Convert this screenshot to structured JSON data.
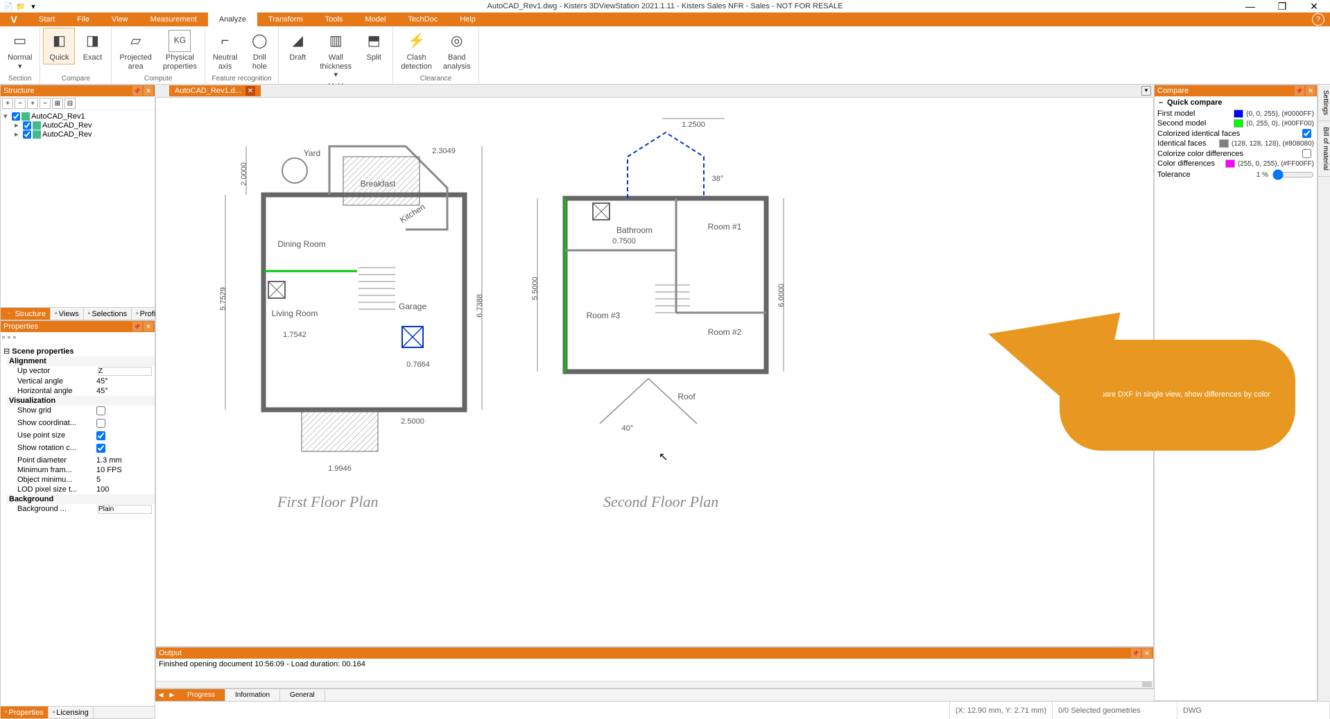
{
  "title": "AutoCAD_Rev1.dwg - Kisters 3DViewStation 2021.1.11 - Kisters Sales NFR - Sales - NOT FOR RESALE",
  "tabs": [
    "Start",
    "File",
    "View",
    "Measurement",
    "Analyze",
    "Transform",
    "Tools",
    "Model",
    "TechDoc",
    "Help"
  ],
  "active_tab": "Analyze",
  "app_tab": "V",
  "ribbon": {
    "groups": [
      {
        "label": "Section",
        "items": [
          {
            "l": "Normal"
          }
        ]
      },
      {
        "label": "Compare",
        "items": [
          {
            "l": "Quick",
            "hl": true
          },
          {
            "l": "Exact"
          }
        ]
      },
      {
        "label": "Compute",
        "items": [
          {
            "l": "Projected\narea"
          },
          {
            "l": "Physical\nproperties"
          }
        ]
      },
      {
        "label": "Feature recognition",
        "items": [
          {
            "l": "Neutral\naxis"
          },
          {
            "l": "Drill\nhole"
          }
        ]
      },
      {
        "label": "Mold",
        "items": [
          {
            "l": "Draft"
          },
          {
            "l": "Wall\nthickness"
          },
          {
            "l": "Split"
          }
        ]
      },
      {
        "label": "Clearance",
        "items": [
          {
            "l": "Clash\ndetection"
          },
          {
            "l": "Band\nanalysis"
          }
        ]
      }
    ]
  },
  "structure_header": "Structure",
  "tree": [
    {
      "lvl": 0,
      "name": "AutoCAD_Rev1"
    },
    {
      "lvl": 1,
      "name": "AutoCAD_Rev"
    },
    {
      "lvl": 1,
      "name": "AutoCAD_Rev"
    }
  ],
  "structure_tabs": [
    "Structure",
    "Views",
    "Selections",
    "Profiles"
  ],
  "properties_header": "Properties",
  "scene_props_title": "Scene properties",
  "prop_groups": {
    "alignment": "Alignment",
    "visualization": "Visualization",
    "background": "Background"
  },
  "props": {
    "up_vector": {
      "k": "Up vector",
      "v": "Z"
    },
    "vertical_angle": {
      "k": "Vertical angle",
      "v": "45°"
    },
    "horizontal_angle": {
      "k": "Horizontal angle",
      "v": "45°"
    },
    "show_grid": {
      "k": "Show grid",
      "v": false
    },
    "show_coord": {
      "k": "Show coordinat...",
      "v": false
    },
    "use_point_size": {
      "k": "Use point size",
      "v": true
    },
    "show_rotation": {
      "k": "Show rotation c...",
      "v": true
    },
    "point_diameter": {
      "k": "Point diameter",
      "v": "1.3 mm"
    },
    "min_fram": {
      "k": "Minimum fram...",
      "v": "10 FPS"
    },
    "obj_min": {
      "k": "Object minimu...",
      "v": "5"
    },
    "lod_pixel": {
      "k": "LOD pixel size t...",
      "v": "100"
    },
    "background": {
      "k": "Background ...",
      "v": "Plain"
    }
  },
  "bottom_tabs": [
    "Properties",
    "Licensing"
  ],
  "doc_tab": "AutoCAD_Rev1.d...",
  "floorplan": {
    "first_title": "First Floor Plan",
    "second_title": "Second Floor Plan",
    "rooms_first": {
      "yard": "Yard",
      "breakfast": "Breakfast",
      "kitchen": "Kitchen",
      "dining": "Dining Room",
      "living": "Living Room",
      "garage": "Garage"
    },
    "dims_first": {
      "w_yard": "2.0000",
      "diag": "2.3049",
      "h_left": "5.7529",
      "h_right": "6.7388",
      "w_living": "1.7542",
      "w_garage": "2.5000",
      "w_entry": "1.9946",
      "box": "0.7664"
    },
    "rooms_second": {
      "bathroom": "Bathroom",
      "room1": "Room #1",
      "room2": "Room #2",
      "room3": "Room #3",
      "roof": "Roof"
    },
    "dims_second": {
      "top": "1.2500",
      "bath": "0.7500",
      "left": "5.5000",
      "right": "6.0000",
      "angle_top": "38°",
      "angle_bot": "40°"
    }
  },
  "output_header": "Output",
  "output_text": "Finished opening document 10:56:09 - Load duration: 00.164",
  "output_tabs": [
    "Progress",
    "Information",
    "General"
  ],
  "compare_header": "Compare",
  "compare": {
    "title": "Quick compare",
    "rows": [
      {
        "k": "First model",
        "color": "#0000FF",
        "val": "(0, 0, 255), (#0000FF)"
      },
      {
        "k": "Second model",
        "color": "#00FF00",
        "val": "(0, 255, 0), (#00FF00)"
      },
      {
        "k": "Colorized identical faces",
        "check": true
      },
      {
        "k": "Identical faces",
        "color": "#808080",
        "val": "(128, 128, 128), (#808080)"
      },
      {
        "k": "Colorize color differences",
        "check": false
      },
      {
        "k": "Color differences",
        "color": "#FF00FF",
        "val": "(255, 0, 255), (#FF00FF)"
      },
      {
        "k": "Tolerance",
        "val": "1 %",
        "slider": true
      }
    ]
  },
  "side_tabs": [
    "Settings",
    "Bill of material"
  ],
  "status": {
    "coords": "(X: 12.90 mm, Y: 2.71 mm)",
    "sel": "0/0 Selected geometries",
    "fmt": "DWG"
  },
  "callout": "Compare DXF in single view, show differences by color"
}
